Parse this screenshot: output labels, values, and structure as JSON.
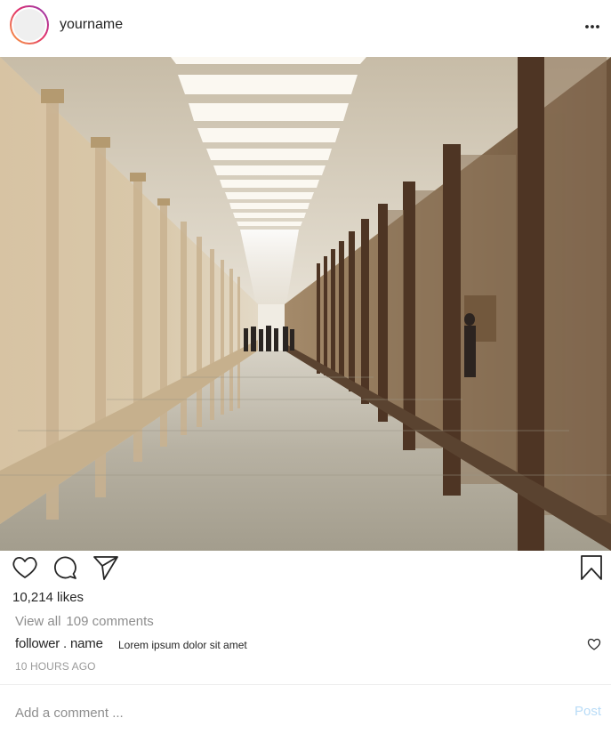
{
  "header": {
    "username": "yourname",
    "avatar_ring_colors": [
      "#f9a541",
      "#e1306c",
      "#8a3ab9"
    ],
    "more_icon": "more-horizontal-icon"
  },
  "photo": {
    "subject": "corridor photograph"
  },
  "actions": {
    "like_icon": "heart-icon",
    "comment_icon": "comment-icon",
    "share_icon": "send-icon",
    "save_icon": "bookmark-icon"
  },
  "likes_text": "10,214 likes",
  "comments": {
    "view_all_prefix": "View all",
    "view_all_count": "109 comments",
    "items": [
      {
        "user": "follower . name",
        "text": "Lorem ipsum dolor sit amet",
        "like_icon": "heart-icon"
      }
    ]
  },
  "timestamp": "10 HOURS AGO",
  "add_comment": {
    "placeholder": "Add a comment ...",
    "value": "",
    "post_label": "Post",
    "post_color": "#b9dcf7"
  }
}
